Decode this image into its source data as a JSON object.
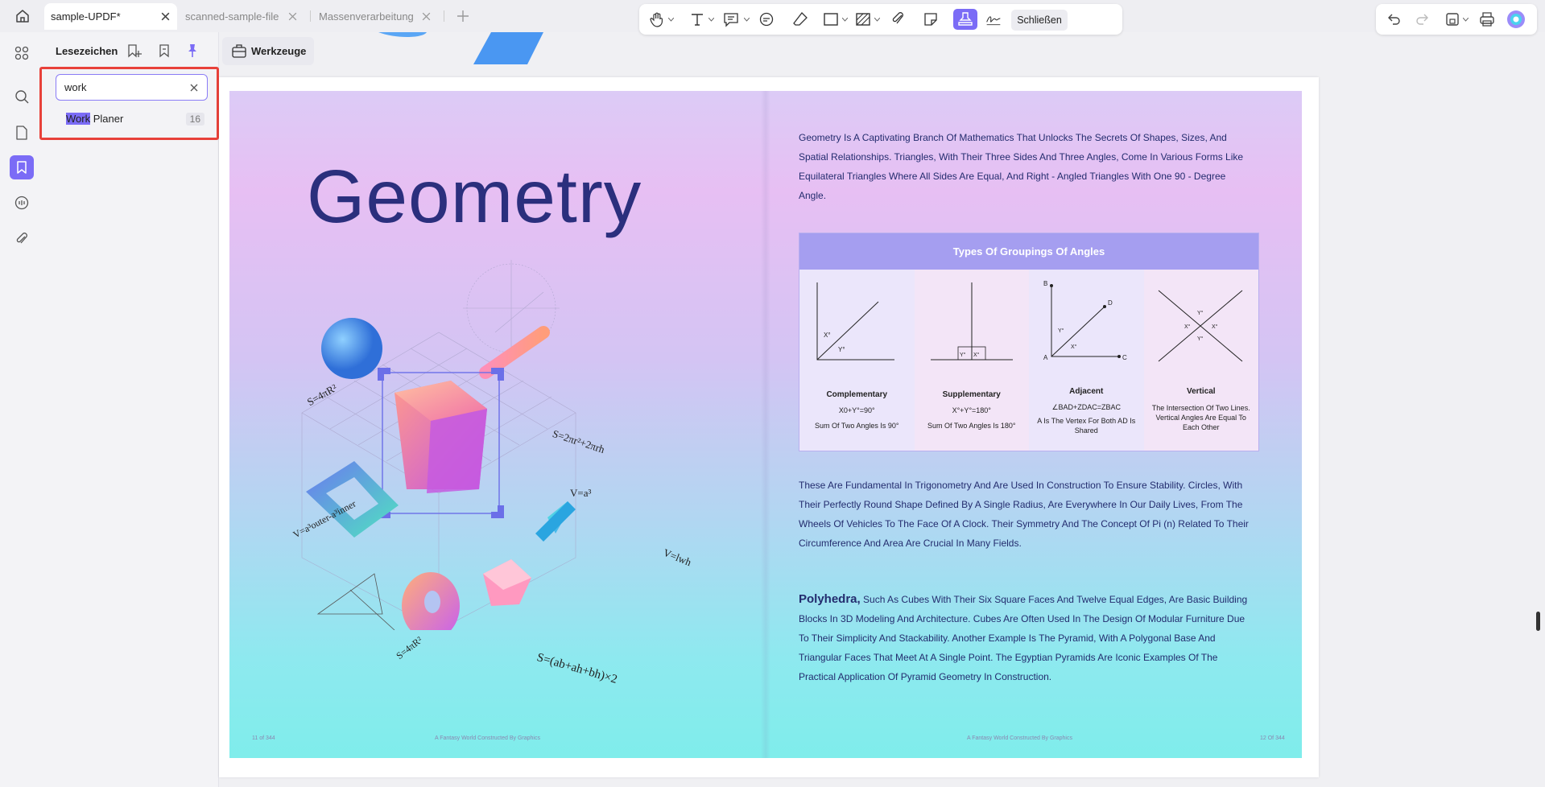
{
  "tabs": [
    {
      "label": "sample-UPDF*",
      "active": true
    },
    {
      "label": "scanned-sample-file",
      "active": false
    },
    {
      "label": "Massenverarbeitung",
      "active": false
    }
  ],
  "panel": {
    "title": "Lesezeichen",
    "search_value": "work",
    "result": {
      "highlight": "Work",
      "rest": " Planer",
      "count": "16"
    }
  },
  "toolbar": {
    "werkzeuge_label": "Werkzeuge",
    "close_label": "Schließen"
  },
  "page": {
    "title": "Geometry",
    "intro": "Geometry Is A Captivating Branch Of Mathematics That Unlocks The Secrets Of Shapes, Sizes, And Spatial Relationships. Triangles, With Their Three Sides And Three Angles, Come In Various Forms Like Equilateral Triangles Where All Sides Are Equal, And Right - Angled Triangles With One 90 - Degree Angle.",
    "table_title": "Types Of Groupings Of Angles",
    "angles": [
      {
        "name": "Complementary",
        "f1": "X0+Y°=90°",
        "f2": "Sum Of Two Angles Is 90°"
      },
      {
        "name": "Supplementary",
        "f1": "X°+Y°=180°",
        "f2": "Sum Of Two Angles Is 180°"
      },
      {
        "name": "Adjacent",
        "f1": "∠BAD+ZDAC=ZBAC",
        "f2": "A Is The Vertex For Both AD Is Shared"
      },
      {
        "name": "Vertical",
        "f1": "",
        "f2": "The Intersection Of Two Lines. Vertical Angles Are Equal To Each Other"
      }
    ],
    "para2": "These Are Fundamental In Trigonometry And Are Used In Construction To Ensure Stability. Circles, With Their Perfectly Round Shape Defined By A Single Radius, Are Everywhere In Our Daily Lives, From The Wheels Of Vehicles To The Face Of A Clock. Their Symmetry And The Concept Of Pi (n) Related To Their Circumference And Area Are Crucial In Many Fields.",
    "poly_head": "Polyhedra,",
    "para3": " Such As Cubes With Their Six Square Faces And Twelve Equal Edges, Are Basic Building Blocks In 3D Modeling And Architecture. Cubes Are Often Used In The Design Of Modular Furniture Due To Their Simplicity And Stackability. Another Example Is The Pyramid, With A Polygonal Base And Triangular Faces That Meet At A Single Point. The Egyptian Pyramids Are Iconic Examples Of The Practical Application Of Pyramid Geometry In Construction.",
    "formulas": {
      "sphere": "S=4πR²",
      "cyl": "S=2πr²+2πrh",
      "cube": "V=a³",
      "frame": "V=a³outer-a³inner",
      "prism": "V=lwh",
      "torus": "S=4πR²",
      "box": "S=(ab+ah+bh)×2"
    },
    "footer_left_num": "11 of 344",
    "footer_left": "A Fantasy World Constructed By Graphics",
    "footer_right": "A Fantasy World Constructed By Graphics",
    "footer_right_num": "12 Of 344"
  },
  "colors": {
    "accent": "#7b6cf6",
    "highlight_box": "#e8413a",
    "title": "#2b2f7d"
  }
}
